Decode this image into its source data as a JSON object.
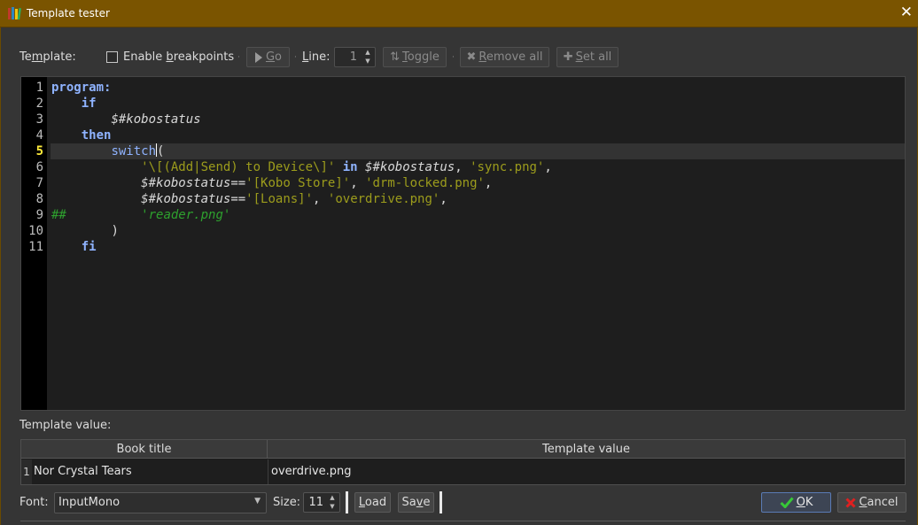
{
  "window": {
    "title": "Template tester",
    "close_symbol": "✕",
    "icon": "books-icon"
  },
  "toolbar": {
    "template_label_pre": "Te",
    "template_label_ul": "m",
    "template_label_post": "plate:",
    "enable_breakpoints_pre": "Enable ",
    "enable_breakpoints_ul": "b",
    "enable_breakpoints_post": "reakpoints",
    "breakpoints_checked": false,
    "go_ul": "G",
    "go_rest": "o",
    "line_ul": "L",
    "line_rest": "ine:",
    "line_value": "1",
    "toggle_ul": "T",
    "toggle_rest": "oggle",
    "remove_all_ul": "R",
    "remove_all_rest": "emove all",
    "set_all_ul": "S",
    "set_all_rest": "et all"
  },
  "editor": {
    "current_line": 5,
    "line_numbers": [
      "1",
      "2",
      "3",
      "4",
      "5",
      "6",
      "7",
      "8",
      "9",
      "10",
      "11"
    ],
    "lines": {
      "l1_kw": "program:",
      "l2_kw": "if",
      "l3_var": "$#kobostatus",
      "l4_kw": "then",
      "l5_fn": "switch",
      "l5_paren": "(",
      "l6_str": "'\\[(Add|Send) to Device\\]'",
      "l6_kw": "in",
      "l6_var": "$#kobostatus",
      "l6_comma": ",",
      "l6_str2": "'sync.png'",
      "l6_end": ",",
      "l7_var": "$#kobostatus",
      "l7_op": "==",
      "l7_str": "'[Kobo Store]'",
      "l7_comma": ",",
      "l7_str2": "'drm-locked.png'",
      "l7_end": ",",
      "l8_var": "$#kobostatus",
      "l8_op": "==",
      "l8_str": "'[Loans]'",
      "l8_comma": ",",
      "l8_str2": "'overdrive.png'",
      "l8_end": ",",
      "l9_hash": "##",
      "l9_str": "'reader.png'",
      "l10_paren": ")",
      "l11_kw": "fi"
    }
  },
  "result": {
    "label": "Template value:",
    "headers": {
      "book_title": "Book title",
      "template_value": "Template value"
    },
    "rows": [
      {
        "num": "1",
        "book_title": "Nor Crystal Tears",
        "template_value": "overdrive.png"
      }
    ]
  },
  "bottom": {
    "font_label": "Font:",
    "font_value": "InputMono",
    "size_label": "Size:",
    "size_value": "11",
    "load_ul": "L",
    "load_rest": "oad",
    "save_pre": "Sa",
    "save_ul": "v",
    "save_post": "e",
    "ok_ul": "O",
    "ok_rest": "K",
    "cancel_ul": "C",
    "cancel_rest": "ancel"
  },
  "colors": {
    "titlebar": "#7a5400",
    "keyword": "#8fb3ff",
    "string": "#9c9c1c",
    "comment": "#2ea12e",
    "current_line_number": "#ffeb3b"
  }
}
